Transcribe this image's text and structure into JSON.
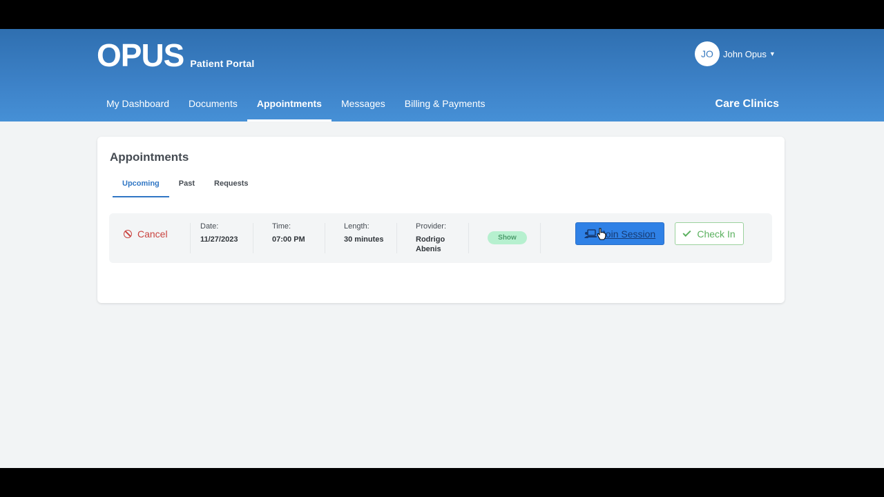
{
  "header": {
    "logo_text": "OPUS",
    "logo_subtitle": "Patient Portal",
    "user": {
      "initials": "JO",
      "name": "John Opus"
    },
    "nav": [
      {
        "label": "My Dashboard",
        "active": false
      },
      {
        "label": "Documents",
        "active": false
      },
      {
        "label": "Appointments",
        "active": true
      },
      {
        "label": "Messages",
        "active": false
      },
      {
        "label": "Billing & Payments",
        "active": false
      }
    ],
    "organization": "Care Clinics"
  },
  "appointments": {
    "title": "Appointments",
    "tabs": [
      {
        "label": "Upcoming",
        "active": true
      },
      {
        "label": "Past",
        "active": false
      },
      {
        "label": "Requests",
        "active": false
      }
    ],
    "item": {
      "cancel_label": "Cancel",
      "date_label": "Date:",
      "date_value": "11/27/2023",
      "time_label": "Time:",
      "time_value": "07:00 PM",
      "length_label": "Length:",
      "length_value": "30 minutes",
      "provider_label": "Provider:",
      "provider_value_first": "Rodrigo",
      "provider_value_last": "Abenis",
      "status_badge": "Show",
      "join_label": "Join Session",
      "checkin_label": "Check In"
    }
  },
  "colors": {
    "header_gradient_top": "#2f6fb0",
    "header_gradient_bottom": "#4690d6",
    "accent_blue": "#2f76c4",
    "cancel_red": "#c9433f",
    "checkin_green": "#5ab05e",
    "badge_bg": "#b6f0cf"
  },
  "icons": {
    "cancel": "ban-icon",
    "join": "laptop-user-icon",
    "checkin": "check-icon",
    "user_menu": "caret-down-icon"
  }
}
